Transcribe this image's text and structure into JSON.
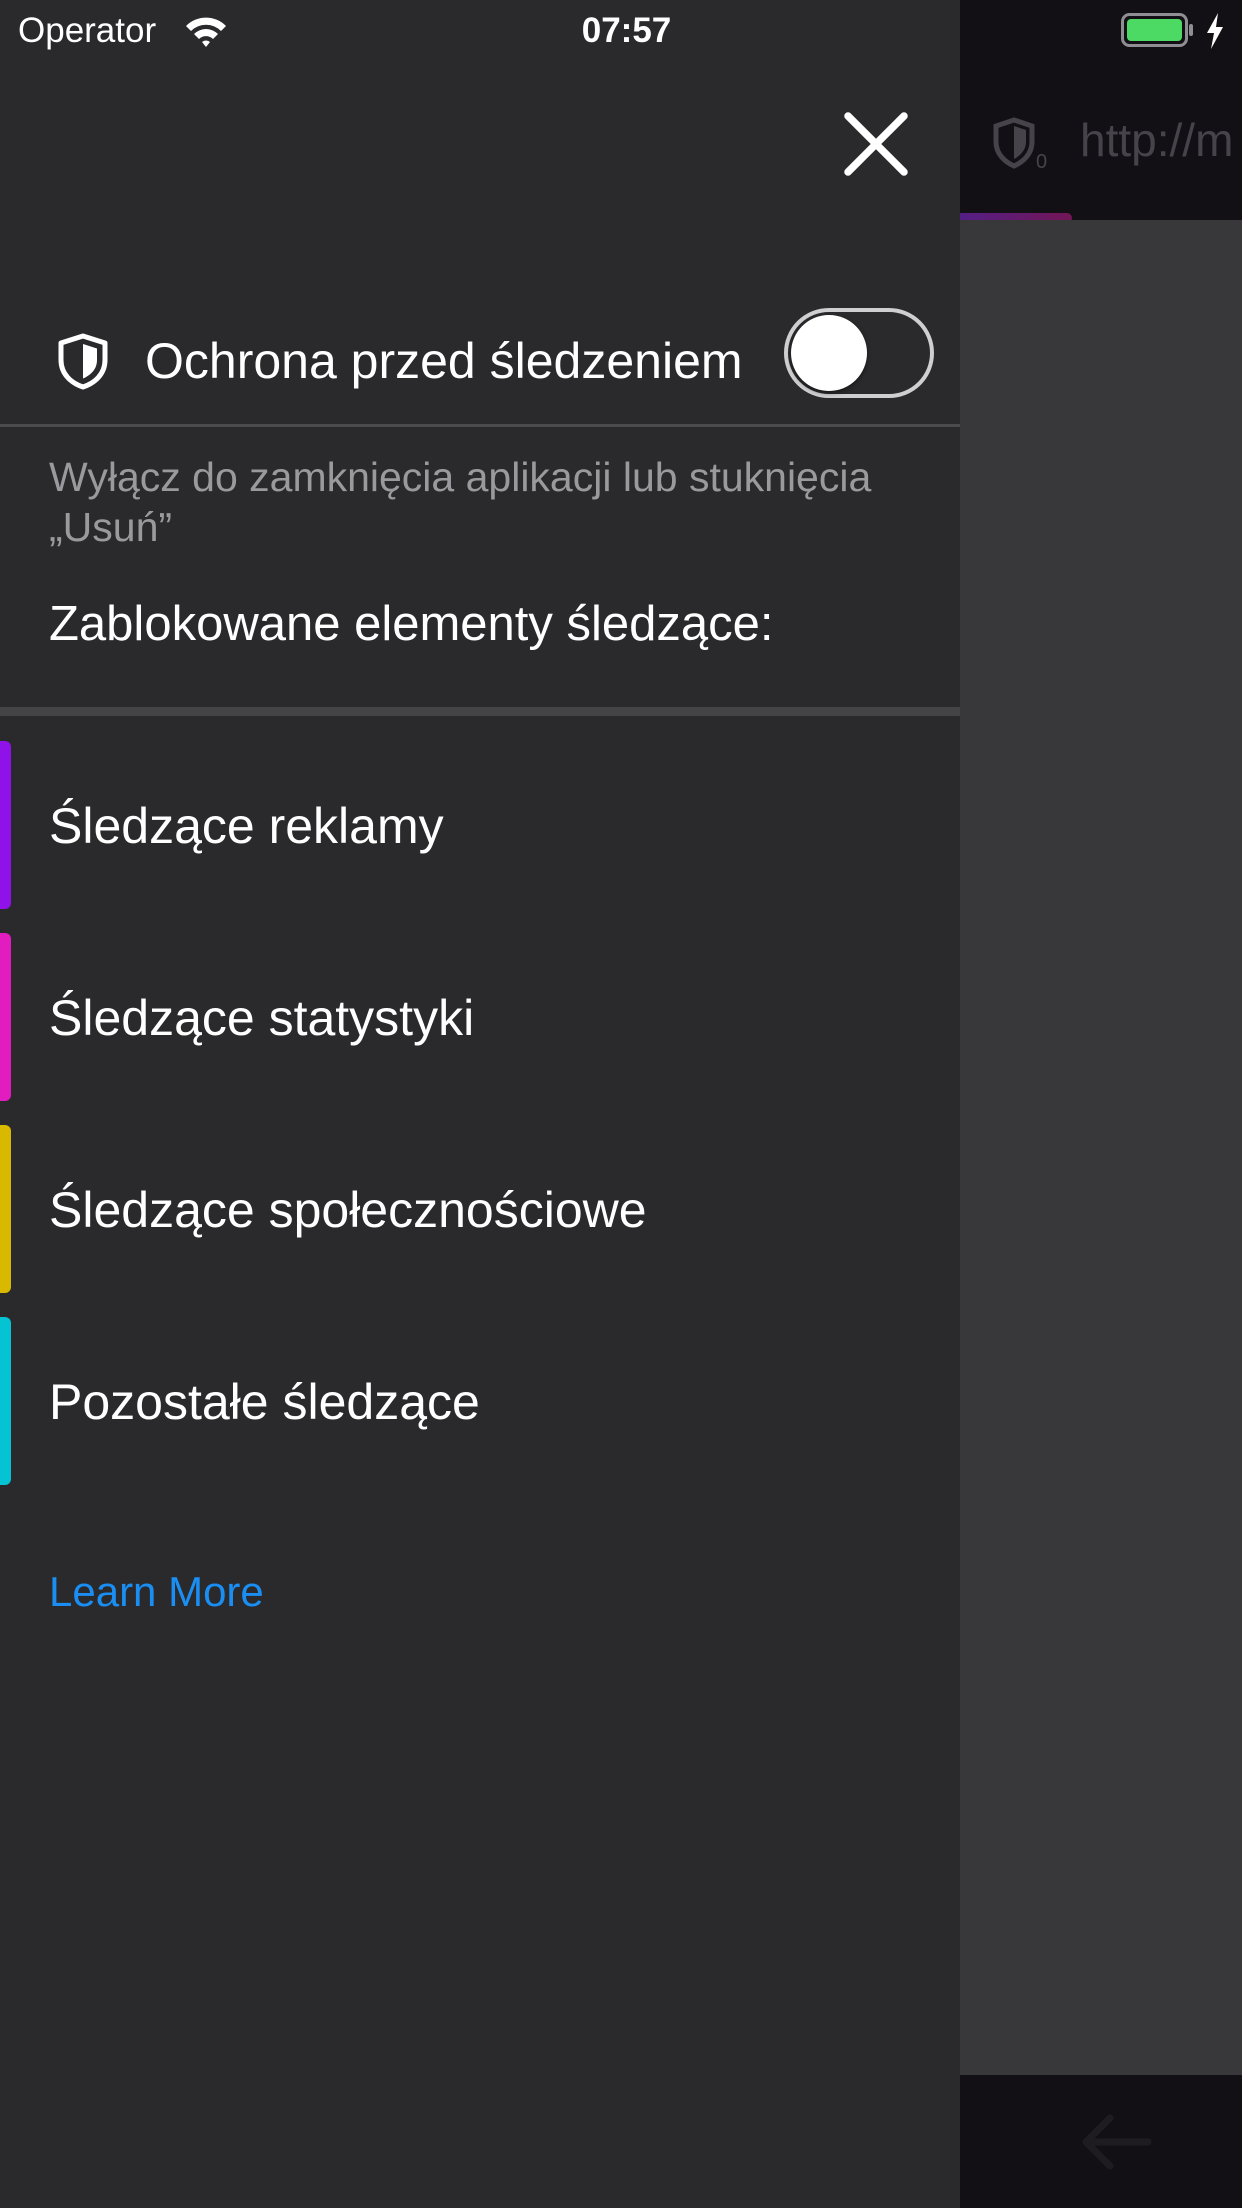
{
  "status_bar": {
    "carrier": "Operator",
    "time": "07:57",
    "wifi_icon": "wifi-icon",
    "battery_icon": "battery-icon",
    "charging_icon": "bolt-icon",
    "battery_color": "#4cd964"
  },
  "browser": {
    "url_text": "http://m",
    "shield_icon": "shield-icon",
    "back_icon": "back-arrow-icon"
  },
  "panel": {
    "close_icon": "close-icon",
    "tracking_protection": {
      "icon": "shield-icon",
      "label": "Ochrona przed śledzeniem",
      "toggle_on": false
    },
    "disable_note": "Wyłącz do zamknięcia aplikacji lub stuknięcia „Usuń”",
    "blocked_heading": "Zablokowane elementy śledzące:",
    "trackers": [
      {
        "label": "Śledzące reklamy",
        "color": "#8f13e8"
      },
      {
        "label": "Śledzące statystyki",
        "color": "#e21dbf"
      },
      {
        "label": "Śledzące społecznościowe",
        "color": "#d9b800"
      },
      {
        "label": "Pozostałe śledzące",
        "color": "#06c3d4"
      }
    ],
    "learn_more": "Learn More",
    "link_color": "#1a8ef2"
  }
}
